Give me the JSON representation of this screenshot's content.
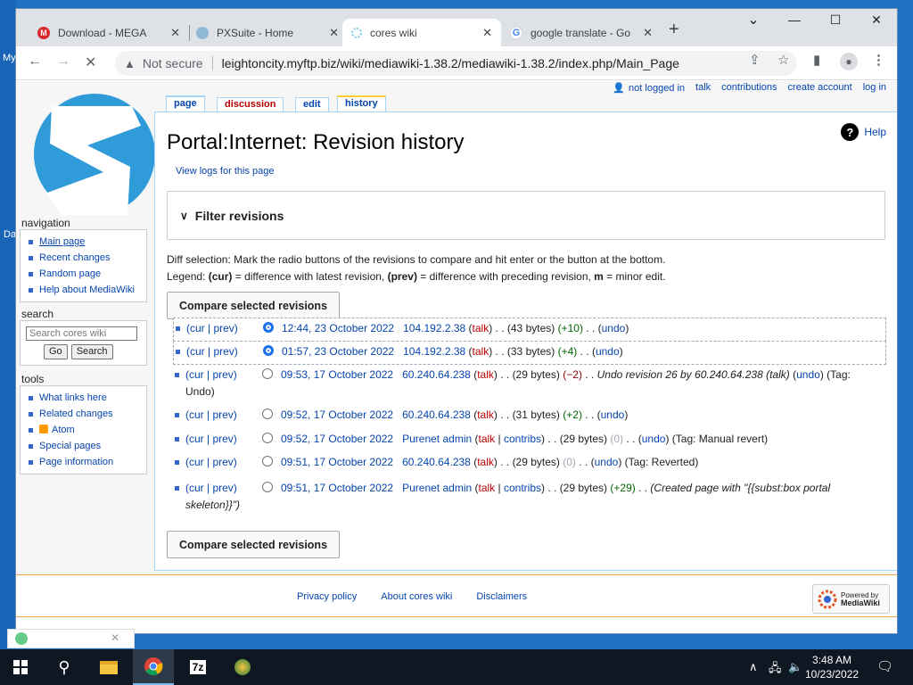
{
  "browser": {
    "tabs": [
      {
        "title": "Download - MEGA",
        "favicon": "mega-icon",
        "color": "#d9272e",
        "glyph": "M"
      },
      {
        "title": "PXSuite - Home",
        "favicon": "pxsuite-icon",
        "color": "#8fb9d6",
        "glyph": ""
      },
      {
        "title": "cores wiki",
        "favicon": "wiki-icon",
        "color": "#7ecde3",
        "glyph": ""
      },
      {
        "title": "google translate - Go",
        "favicon": "google-icon",
        "color": "#4285f4",
        "glyph": "G"
      }
    ],
    "new_tab": "+",
    "window_controls": {
      "minimize": "—",
      "maximize": "☐",
      "close": "✕",
      "dropdown": "⌄"
    },
    "address": {
      "security": "Not secure",
      "url": "leightoncity.myftp.biz/wiki/mediawiki-1.38.2/mediawiki-1.38.2/index.php/Main_Page"
    }
  },
  "wiki": {
    "personal": {
      "user": "not logged in",
      "talk": "talk",
      "contributions": "contributions",
      "create": "create account",
      "login": "log in"
    },
    "page_tabs": {
      "page": "page",
      "discussion": "discussion",
      "edit": "edit",
      "history": "history"
    },
    "title": "Portal:Internet: Revision history",
    "help": "Help",
    "view_logs": "View logs for this page",
    "filter": "Filter revisions",
    "legend_line1": "Diff selection: Mark the radio buttons of the revisions to compare and hit enter or the button at the bottom.",
    "legend_line2_parts": [
      "Legend: ",
      "(cur)",
      " = difference with latest revision, ",
      "(prev)",
      " = difference with preceding revision, ",
      "m",
      " = minor edit."
    ],
    "compare_label": "Compare selected revisions",
    "sidebar": {
      "nav_heading": "navigation",
      "nav_items": [
        "Main page",
        "Recent changes",
        "Random page",
        "Help about MediaWiki"
      ],
      "search_heading": "search",
      "search_placeholder": "Search cores wiki",
      "go": "Go",
      "search": "Search",
      "tools_heading": "tools",
      "tools_items": [
        "What links here",
        "Related changes",
        "Atom",
        "Special pages",
        "Page information"
      ]
    },
    "revisions": [
      {
        "cur": "(cur | prev)",
        "time": "12:44, 23 October 2022",
        "user": "104.192.2.38",
        "talk": "talk",
        "contribs": "",
        "size": "(43 bytes)",
        "diff": "(+10)",
        "diff_type": "pos",
        "summary": "",
        "tag": "",
        "undo": "undo",
        "selected": true
      },
      {
        "cur": "(cur | prev)",
        "time": "01:57, 23 October 2022",
        "user": "104.192.2.38",
        "talk": "talk",
        "contribs": "",
        "size": "(33 bytes)",
        "diff": "(+4)",
        "diff_type": "pos",
        "summary": "",
        "tag": "",
        "undo": "undo",
        "selected": true
      },
      {
        "cur": "(cur | prev)",
        "time": "09:53, 17 October 2022",
        "user": "60.240.64.238",
        "talk": "talk",
        "contribs": "",
        "size": "(29 bytes)",
        "diff": "(−2)",
        "diff_type": "neg",
        "summary": "Undo revision 26 by 60.240.64.238 (talk)",
        "tag": "(Tag: Undo)",
        "undo": "undo",
        "selected": false
      },
      {
        "cur": "(cur | prev)",
        "time": "09:52, 17 October 2022",
        "user": "60.240.64.238",
        "talk": "talk",
        "contribs": "",
        "size": "(31 bytes)",
        "diff": "(+2)",
        "diff_type": "pos",
        "summary": "",
        "tag": "",
        "undo": "undo",
        "selected": false
      },
      {
        "cur": "(cur | prev)",
        "time": "09:52, 17 October 2022",
        "user": "Purenet admin",
        "talk": "talk",
        "contribs": "contribs",
        "size": "(29 bytes)",
        "diff": "(0)",
        "diff_type": "neutral",
        "summary": "",
        "tag": "(Tag: Manual revert)",
        "undo": "undo",
        "selected": false
      },
      {
        "cur": "(cur | prev)",
        "time": "09:51, 17 October 2022",
        "user": "60.240.64.238",
        "talk": "talk",
        "contribs": "",
        "size": "(29 bytes)",
        "diff": "(0)",
        "diff_type": "neutral",
        "summary": "",
        "tag": "(Tag: Reverted)",
        "undo": "undo",
        "selected": false
      },
      {
        "cur": "(cur | prev)",
        "time": "09:51, 17 October 2022",
        "user": "Purenet admin",
        "talk": "talk",
        "contribs": "contribs",
        "size": "(29 bytes)",
        "diff": "(+29)",
        "diff_type": "pos",
        "summary": "(Created page with \"{{subst:box portal skeleton}}\")",
        "tag": "",
        "undo": "",
        "selected": false
      }
    ],
    "footer": {
      "privacy": "Privacy policy",
      "about": "About cores wiki",
      "disclaimers": "Disclaimers",
      "powered_line1": "Powered by",
      "powered_line2": "MediaWiki"
    }
  },
  "desktop": {
    "icon_labels": [
      "My",
      "Da"
    ],
    "taskbar": {
      "time": "3:48 AM",
      "date": "10/23/2022",
      "app_7z": "7z"
    }
  }
}
